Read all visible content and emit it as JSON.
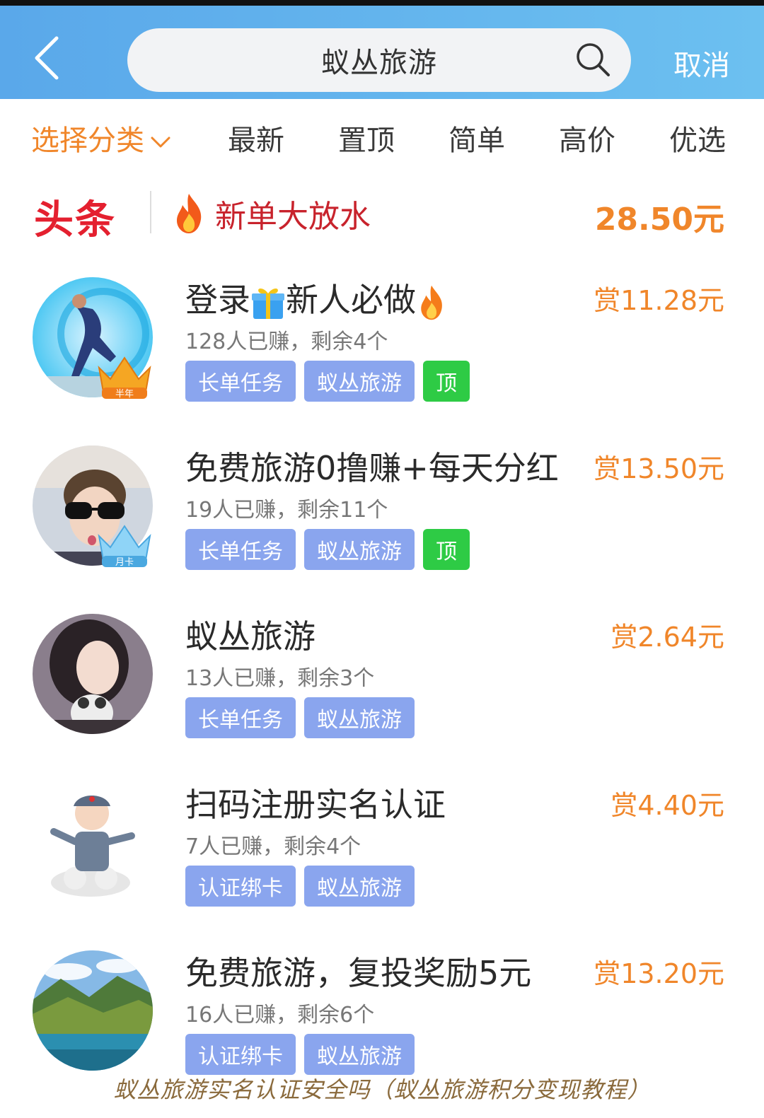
{
  "search": {
    "query": "蚁丛旅游",
    "cancel_label": "取消"
  },
  "filters": {
    "category_label": "选择分类",
    "tabs": [
      "最新",
      "置顶",
      "简单",
      "高价",
      "优选"
    ]
  },
  "headline": {
    "logo": "头条",
    "text": "新单大放水",
    "price": "28.50元"
  },
  "tasks": [
    {
      "title_a": "登录",
      "title_b": "新人必做",
      "reward": "赏11.28元",
      "stats": "128人已赚，剩余4个",
      "tags": [
        "长单任务",
        "蚁丛旅游"
      ],
      "top": "顶",
      "badge": "半年"
    },
    {
      "title": "免费旅游0撸赚+每天分红",
      "reward": "赏13.50元",
      "stats": "19人已赚，剩余11个",
      "tags": [
        "长单任务",
        "蚁丛旅游"
      ],
      "top": "顶",
      "badge": "月卡"
    },
    {
      "title": "蚁丛旅游",
      "reward": "赏2.64元",
      "stats": "13人已赚，剩余3个",
      "tags": [
        "长单任务",
        "蚁丛旅游"
      ]
    },
    {
      "title": "扫码注册实名认证",
      "reward": "赏4.40元",
      "stats": "7人已赚，剩余4个",
      "tags": [
        "认证绑卡",
        "蚁丛旅游"
      ]
    },
    {
      "title": "免费旅游，复投奖励5元",
      "reward": "赏13.20元",
      "stats": "16人已赚，剩余6个",
      "tags": [
        "认证绑卡",
        "蚁丛旅游"
      ]
    }
  ],
  "caption": "蚁丛旅游实名认证安全吗（蚁丛旅游积分变现教程）",
  "colors": {
    "header": "#5aa8ea",
    "accent_orange": "#f0862a",
    "tag_blue": "#8aa5ee",
    "tag_green": "#2ecb45",
    "headline_red": "#e4202f"
  }
}
